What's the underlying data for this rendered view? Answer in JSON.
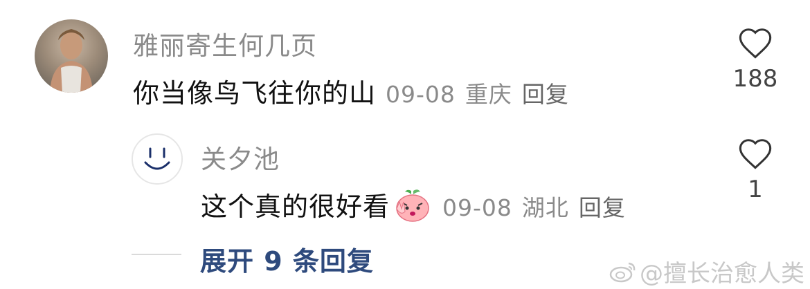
{
  "comment": {
    "username": "雅丽寄生何几页",
    "text": "你当像鸟飞往你的山",
    "date": "09-08",
    "location": "重庆",
    "reply_label": "回复",
    "like_count": "188",
    "avatar_icon": "portrait-photo"
  },
  "reply": {
    "username": "关夕池",
    "text": "这个真的很好看",
    "emoji_icon": "peach-victory-emoji",
    "date": "09-08",
    "location": "湖北",
    "reply_label": "回复",
    "like_count": "1",
    "avatar_icon": "smiley-face-avatar"
  },
  "expand_label": "展开 9 条回复",
  "watermark": "@擅长治愈人类",
  "colors": {
    "username": "#8a8a8a",
    "text": "#111111",
    "link": "#2e4a7d",
    "watermark": "#c8c8c8"
  }
}
